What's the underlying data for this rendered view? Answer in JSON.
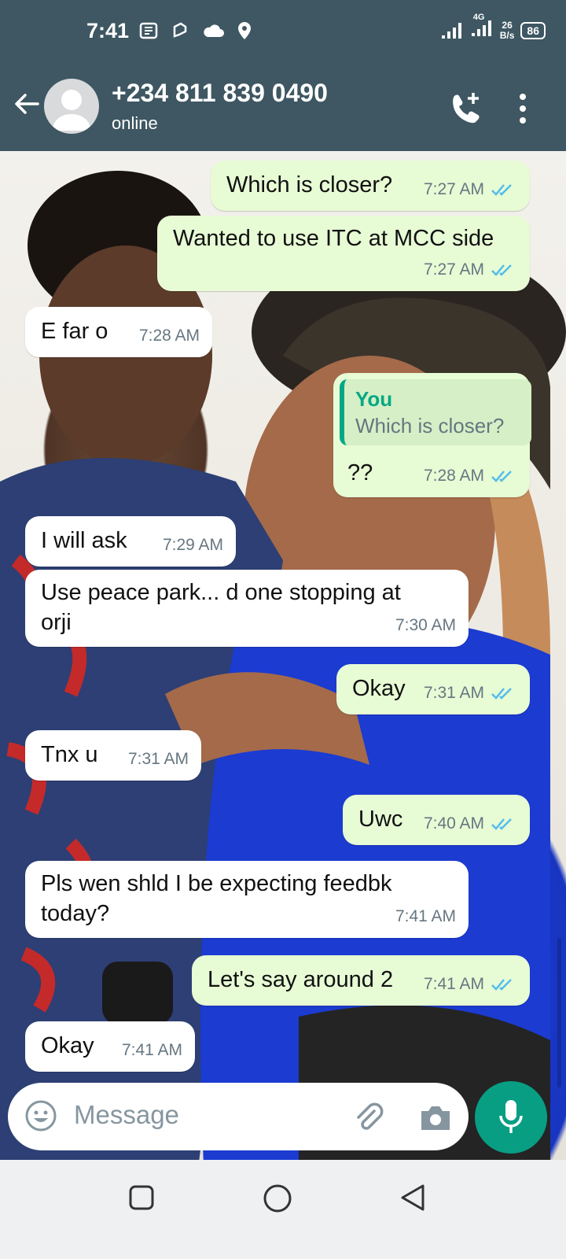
{
  "status_bar": {
    "time": "7:41",
    "network": "4G",
    "speed_value": "26",
    "speed_unit": "B/s",
    "battery": "86"
  },
  "header": {
    "contact": "+234 811 839 0490",
    "status": "online"
  },
  "messages": [
    {
      "dir": "out",
      "text": "Which is closer?",
      "time": "7:27 AM"
    },
    {
      "dir": "out",
      "text": "Wanted to use ITC at MCC side",
      "time": "7:27 AM"
    },
    {
      "dir": "in",
      "text": "E far o",
      "time": "7:28 AM"
    },
    {
      "dir": "out",
      "quote_author": "You",
      "quote_text": "Which is closer?",
      "text": "??",
      "time": "7:28 AM"
    },
    {
      "dir": "in",
      "text": "I will ask",
      "time": "7:29 AM"
    },
    {
      "dir": "in",
      "text": "Use peace park... d one stopping at orji",
      "time": "7:30 AM"
    },
    {
      "dir": "out",
      "text": "Okay",
      "time": "7:31 AM"
    },
    {
      "dir": "in",
      "text": "Tnx u",
      "time": "7:31 AM"
    },
    {
      "dir": "out",
      "text": "Uwc",
      "time": "7:40 AM"
    },
    {
      "dir": "in",
      "text": "Pls wen shld I be expecting feedbk today?",
      "time": "7:41 AM"
    },
    {
      "dir": "out",
      "text": "Let's say around 2",
      "time": "7:41 AM"
    },
    {
      "dir": "in",
      "text": "Okay",
      "time": "7:41 AM"
    }
  ],
  "composer": {
    "placeholder": "Message"
  },
  "colors": {
    "header": "#3e5762",
    "outgoing_bubble": "#e7fbd5",
    "incoming_bubble": "#ffffff",
    "read_tick": "#53bdeb",
    "accent": "#079e84"
  }
}
